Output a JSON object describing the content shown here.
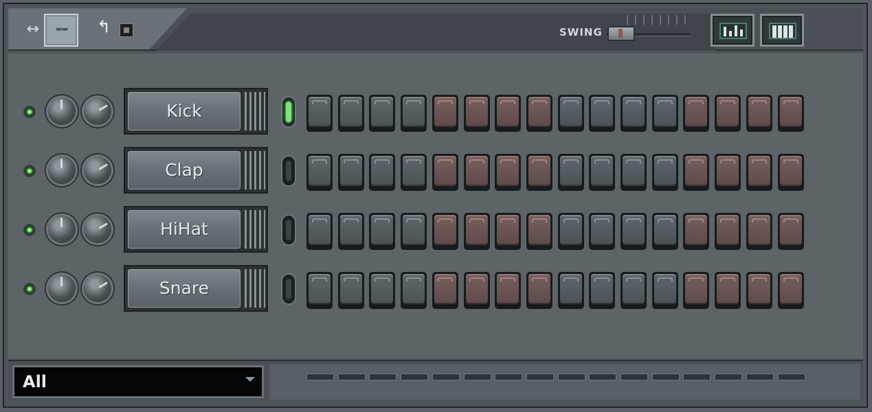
{
  "toolbar": {
    "arrows_icon": "↔",
    "pattern_icon": "--",
    "undo_icon": "↰",
    "swing_label": "SWING",
    "swing_value_percent": 0,
    "graph_view_icon": "graph-editor-icon",
    "keyboard_view_icon": "piano-keys-icon"
  },
  "channels": [
    {
      "name": "Kick",
      "selected": true,
      "muted": false,
      "steps": [
        false,
        false,
        false,
        false,
        false,
        false,
        false,
        false,
        false,
        false,
        false,
        false,
        false,
        false,
        false,
        false
      ]
    },
    {
      "name": "Clap",
      "selected": false,
      "muted": false,
      "steps": [
        false,
        false,
        false,
        false,
        false,
        false,
        false,
        false,
        false,
        false,
        false,
        false,
        false,
        false,
        false,
        false
      ]
    },
    {
      "name": "HiHat",
      "selected": false,
      "muted": false,
      "steps": [
        false,
        false,
        false,
        false,
        false,
        false,
        false,
        false,
        false,
        false,
        false,
        false,
        false,
        false,
        false,
        false
      ]
    },
    {
      "name": "Snare",
      "selected": false,
      "muted": false,
      "steps": [
        false,
        false,
        false,
        false,
        false,
        false,
        false,
        false,
        false,
        false,
        false,
        false,
        false,
        false,
        false,
        false
      ]
    }
  ],
  "colors": {
    "step_dark": "#4b5256",
    "step_alt": "#5e4a49",
    "led_on": "#7fe37a"
  },
  "filter": {
    "selected": "All"
  }
}
